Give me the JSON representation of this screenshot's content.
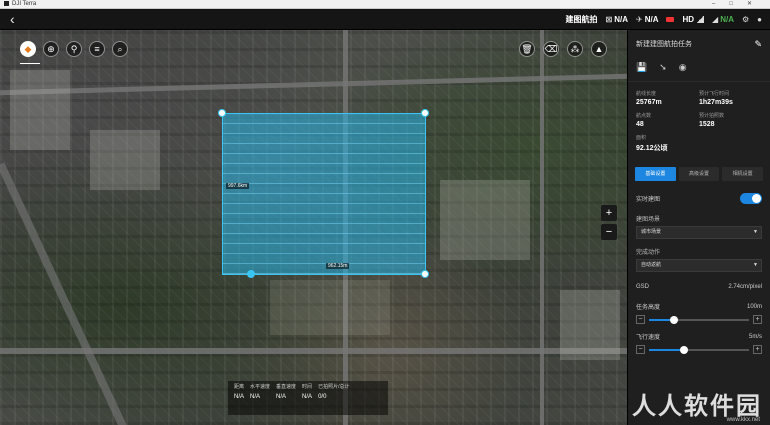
{
  "os": {
    "title": "DJI Terra"
  },
  "topbar": {
    "mode_label": "建图航拍",
    "status": [
      {
        "icon": "satellite-icon",
        "value": "N/A"
      },
      {
        "icon": "drone-icon",
        "value": "N/A"
      },
      {
        "icon": "battery-icon",
        "value": ""
      },
      {
        "icon": "hd-signal-icon",
        "value": "HD"
      },
      {
        "icon": "rc-signal-icon",
        "value": "N/A"
      }
    ]
  },
  "map": {
    "survey": {
      "edge_label_left": "997.6km",
      "edge_label_bottom": "962.15m"
    },
    "zoom_in": "+",
    "zoom_out": "−"
  },
  "stats_bar": [
    {
      "label": "距离",
      "value": "N/A"
    },
    {
      "label": "水平速度",
      "value": "N/A"
    },
    {
      "label": "垂直速度",
      "value": "N/A"
    },
    {
      "label": "时间",
      "value": "N/A"
    },
    {
      "label": "已拍照片/总计",
      "value": "0/0"
    }
  ],
  "panel": {
    "title": "新建建图航拍任务",
    "info": [
      {
        "label": "航线长度",
        "value": "25767m"
      },
      {
        "label": "预计飞行时间",
        "value": "1h27m39s"
      },
      {
        "label": "航点数",
        "value": "48"
      },
      {
        "label": "预计拍照数",
        "value": "1528"
      }
    ],
    "area_label": "面积",
    "area_value": "92.12公顷",
    "tabs": [
      "基础设置",
      "高级设置",
      "相机设置"
    ],
    "realtime_label": "实时建图",
    "scene_label": "建图场景",
    "scene_value": "城市场景",
    "finish_label": "完成动作",
    "finish_value": "自动返航",
    "gsd_label": "GSD",
    "gsd_value": "2.74cm/pixel",
    "altitude_label": "任务高度",
    "altitude_value": "100m",
    "altitude_fraction": 0.25,
    "speed_label": "飞行速度",
    "speed_value": "5m/s",
    "speed_fraction": 0.35
  },
  "watermark": {
    "text": "人人软件园",
    "url": "www.kkx.net"
  }
}
